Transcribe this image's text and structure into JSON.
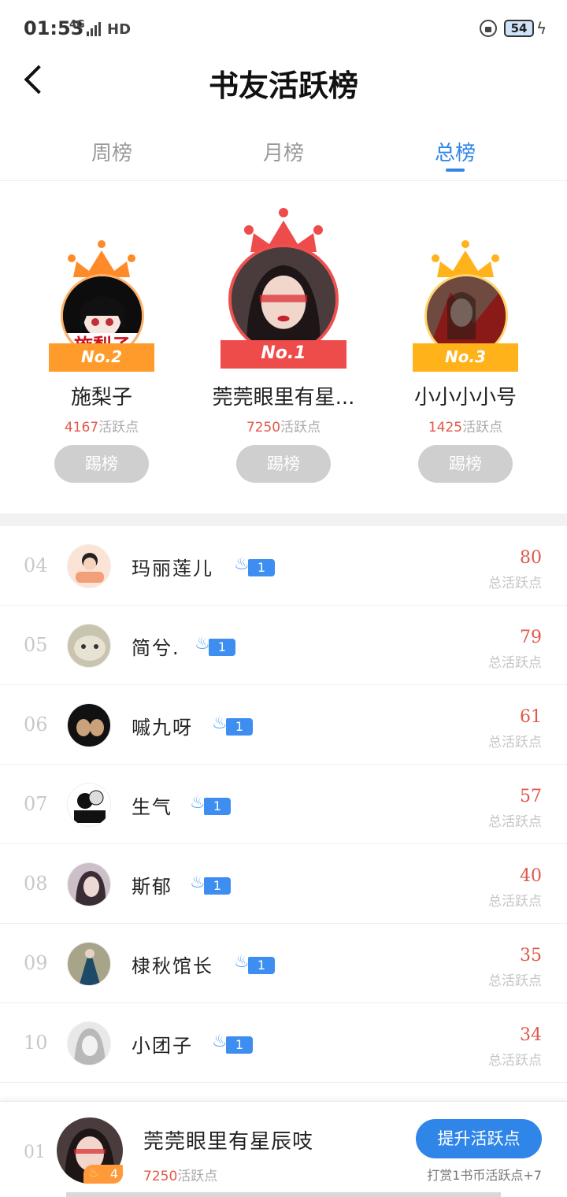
{
  "status": {
    "time": "01:53",
    "network": "4G",
    "hd": "HD",
    "battery": "54"
  },
  "header": {
    "title": "书友活跃榜"
  },
  "tabs": [
    {
      "label": "周榜",
      "active": false
    },
    {
      "label": "月榜",
      "active": false
    },
    {
      "label": "总榜",
      "active": true
    }
  ],
  "podium": {
    "first": {
      "rank_label": "No.1",
      "name": "莞莞眼里有星...",
      "points": "7250",
      "points_suffix": "活跃点",
      "button": "踢榜"
    },
    "second": {
      "rank_label": "No.2",
      "name": "施梨子",
      "avatar_text": "施梨子",
      "points": "4167",
      "points_suffix": "活跃点",
      "button": "踢榜"
    },
    "third": {
      "rank_label": "No.3",
      "name": "小小小小号",
      "points": "1425",
      "points_suffix": "活跃点",
      "button": "踢榜"
    }
  },
  "list": {
    "score_label": "总活跃点",
    "items": [
      {
        "rank": "04",
        "name": "玛丽莲儿",
        "level": "1",
        "score": "80"
      },
      {
        "rank": "05",
        "name": "简兮.",
        "level": "1",
        "score": "79"
      },
      {
        "rank": "06",
        "name": "嘁九呀",
        "level": "1",
        "score": "61"
      },
      {
        "rank": "07",
        "name": "生气",
        "level": "1",
        "score": "57"
      },
      {
        "rank": "08",
        "name": "斯郁",
        "level": "1",
        "score": "40"
      },
      {
        "rank": "09",
        "name": "棣秋馆长",
        "level": "1",
        "score": "35"
      },
      {
        "rank": "10",
        "name": "小团子",
        "level": "1",
        "score": "34"
      }
    ]
  },
  "self": {
    "rank": "01",
    "name": "莞莞眼里有星辰吱",
    "level": "4",
    "points": "7250",
    "points_suffix": "活跃点",
    "boost_button": "提升活跃点",
    "hint": "打赏1书币活跃点+7"
  },
  "colors": {
    "accent": "#2f86e8",
    "score": "#e0584b",
    "gold": "#ffb21a",
    "orange": "#ff9a3a",
    "red": "#ee4b4b"
  }
}
